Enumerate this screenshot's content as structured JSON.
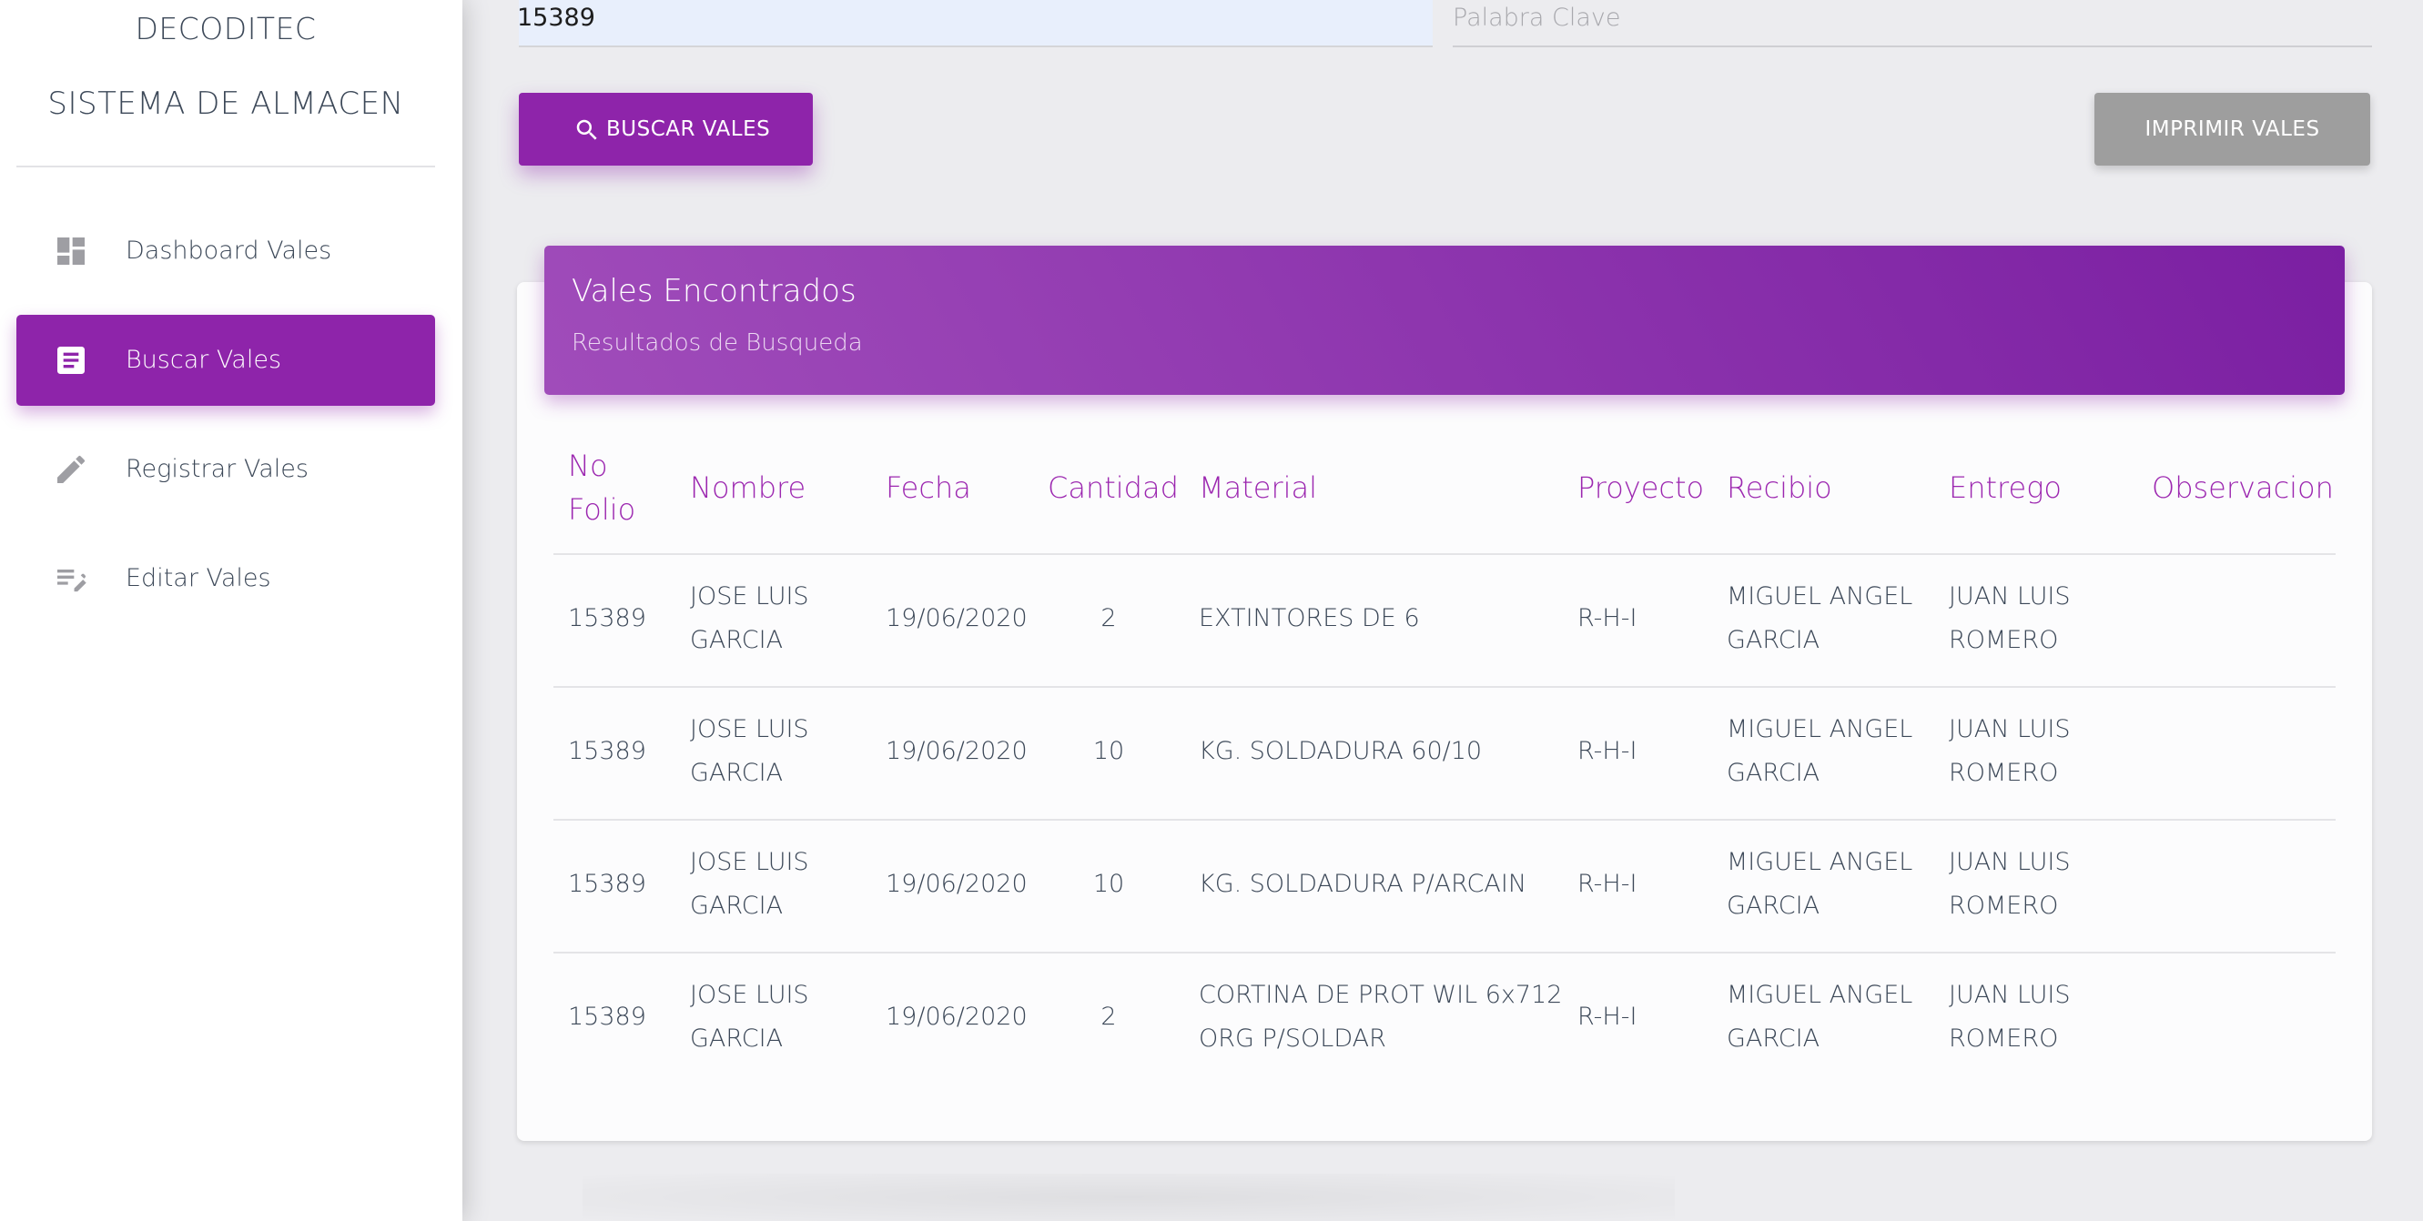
{
  "sidebar": {
    "brand": "DECODITEC",
    "title": "SISTEMA DE ALMACEN",
    "items": [
      {
        "label": "Dashboard Vales",
        "icon": "dashboard-icon"
      },
      {
        "label": "Buscar Vales",
        "icon": "document-icon",
        "active": true
      },
      {
        "label": "Registrar Vales",
        "icon": "pencil-icon"
      },
      {
        "label": "Editar Vales",
        "icon": "edit-list-icon"
      }
    ]
  },
  "search": {
    "folio_value": "15389",
    "keyword_placeholder": "Palabra Clave"
  },
  "actions": {
    "search_label": "BUSCAR VALES",
    "print_label": "IMPRIMIR VALES"
  },
  "results": {
    "title": "Vales Encontrados",
    "subtitle": "Resultados de Busqueda",
    "columns": {
      "folio_line1": "No",
      "folio_line2": "Folio",
      "nombre": "Nombre",
      "fecha": "Fecha",
      "cantidad": "Cantidad",
      "material": "Material",
      "proyecto": "Proyecto",
      "recibio": "Recibio",
      "entrego": "Entrego",
      "observacion": "Observacion"
    },
    "rows": [
      {
        "folio": "15389",
        "nombre1": "JOSE LUIS",
        "nombre2": "GARCIA",
        "fecha": "19/06/2020",
        "cantidad": "2",
        "material1": "EXTINTORES DE 6",
        "material2": "",
        "proyecto": "R-H-I",
        "recibio1": "MIGUEL ANGEL",
        "recibio2": "GARCIA",
        "entrego1": "JUAN LUIS",
        "entrego2": "ROMERO",
        "observacion": ""
      },
      {
        "folio": "15389",
        "nombre1": "JOSE LUIS",
        "nombre2": "GARCIA",
        "fecha": "19/06/2020",
        "cantidad": "10",
        "material1": "KG. SOLDADURA 60/10",
        "material2": "",
        "proyecto": "R-H-I",
        "recibio1": "MIGUEL ANGEL",
        "recibio2": "GARCIA",
        "entrego1": "JUAN LUIS",
        "entrego2": "ROMERO",
        "observacion": ""
      },
      {
        "folio": "15389",
        "nombre1": "JOSE LUIS",
        "nombre2": "GARCIA",
        "fecha": "19/06/2020",
        "cantidad": "10",
        "material1": "KG. SOLDADURA P/ARCAIN",
        "material2": "",
        "proyecto": "R-H-I",
        "recibio1": "MIGUEL ANGEL",
        "recibio2": "GARCIA",
        "entrego1": "JUAN LUIS",
        "entrego2": "ROMERO",
        "observacion": ""
      },
      {
        "folio": "15389",
        "nombre1": "JOSE LUIS",
        "nombre2": "GARCIA",
        "fecha": "19/06/2020",
        "cantidad": "2",
        "material1": "CORTINA DE PROT WIL 6x712",
        "material2": "ORG P/SOLDAR",
        "proyecto": "R-H-I",
        "recibio1": "MIGUEL ANGEL",
        "recibio2": "GARCIA",
        "entrego1": "JUAN LUIS",
        "entrego2": "ROMERO",
        "observacion": ""
      }
    ]
  },
  "colors": {
    "accent": "#8e24aa",
    "header_text": "#9c27b0",
    "print_button": "#9e9e9e"
  }
}
